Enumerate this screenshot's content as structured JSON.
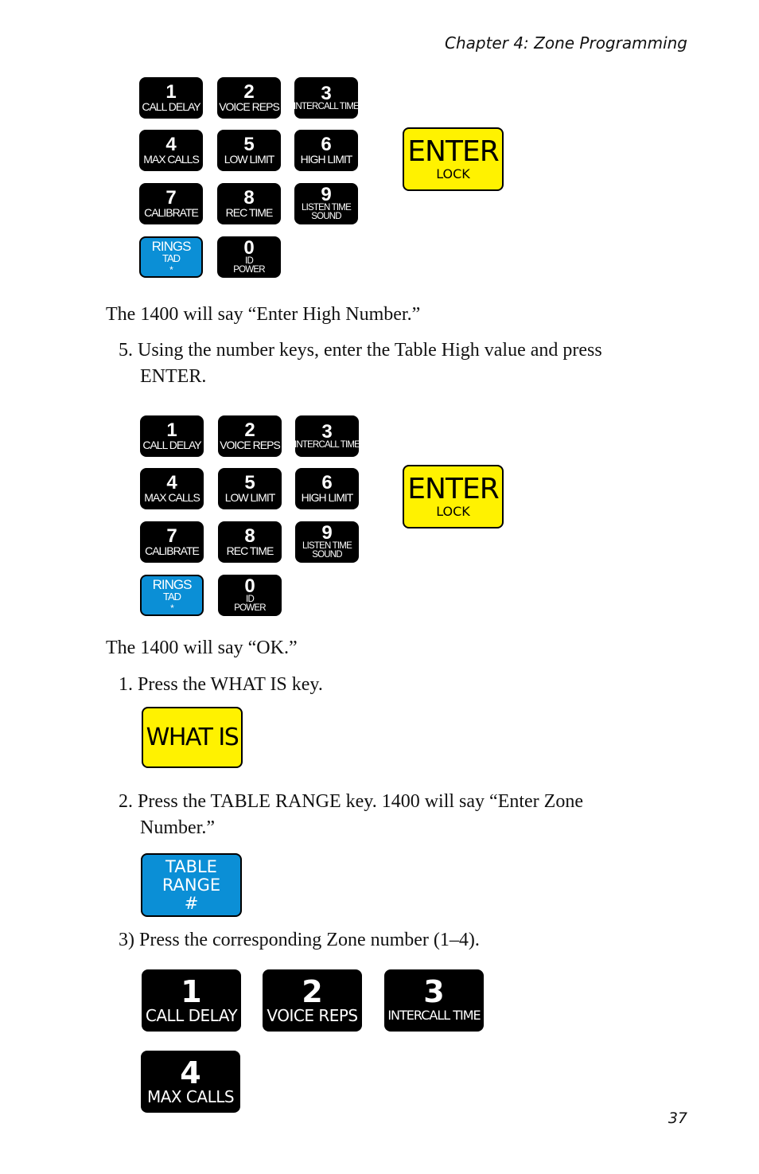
{
  "header": {
    "chapter_title": "Chapter 4: Zone Programming"
  },
  "page_number": "37",
  "keypad_keys": [
    {
      "number": "1",
      "label": "CALL DELAY"
    },
    {
      "number": "2",
      "label": "VOICE REPS"
    },
    {
      "number": "3",
      "label": "INTERCALL TIME"
    },
    {
      "number": "4",
      "label": "MAX CALLS"
    },
    {
      "number": "5",
      "label": "LOW LIMIT"
    },
    {
      "number": "6",
      "label": "HIGH LIMIT"
    },
    {
      "number": "7",
      "label": "CALIBRATE"
    },
    {
      "number": "8",
      "label": "REC TIME"
    },
    {
      "number": "9",
      "label": "LISTEN TIME",
      "label2": "SOUND"
    },
    {
      "number": "0",
      "label": "ID",
      "label2": "POWER"
    }
  ],
  "rings_key": {
    "label": "RINGS",
    "sub": "TAD",
    "symbol": "*"
  },
  "enter_key": {
    "label": "ENTER",
    "sub": "LOCK"
  },
  "text": {
    "p1": "The 1400 will say “Enter High Number.”",
    "step5_line1": "5. Using the number keys, enter the Table High value and press",
    "step5_line2": "ENTER.",
    "p2": "The 1400 will say “OK.”",
    "step1": "1. Press the WHAT IS key.",
    "step2_line1": "2. Press the TABLE RANGE key. 1400 will say “Enter Zone",
    "step2_line2": "Number.”",
    "step3": "3) Press the corresponding Zone number (1–4)."
  },
  "what_is_key": {
    "label": "WHAT IS"
  },
  "table_range_key": {
    "line1": "TABLE",
    "line2": "RANGE",
    "symbol": "#"
  },
  "zone_keys": [
    {
      "number": "1",
      "label": "CALL DELAY"
    },
    {
      "number": "2",
      "label": "VOICE REPS"
    },
    {
      "number": "3",
      "label": "INTERCALL TIME"
    },
    {
      "number": "4",
      "label": "MAX CALLS"
    }
  ]
}
